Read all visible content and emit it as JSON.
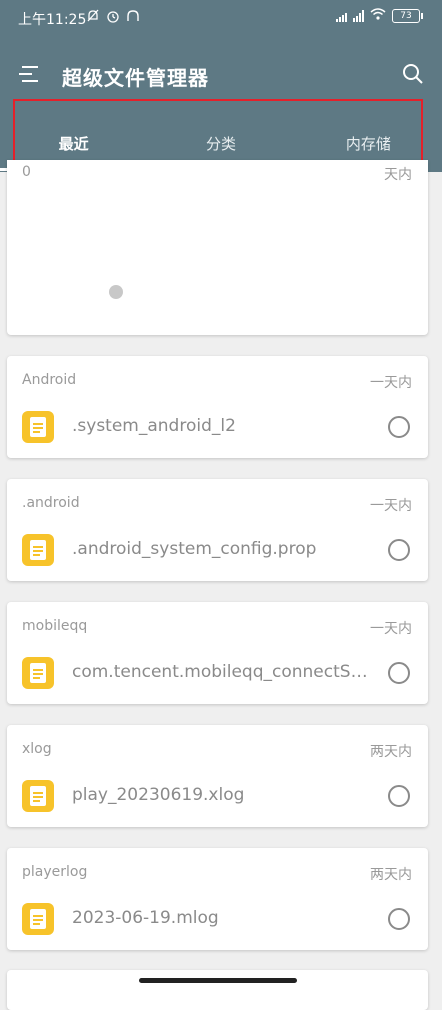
{
  "status_bar": {
    "time": "上午11:25",
    "battery": "73"
  },
  "app": {
    "title": "超级文件管理器"
  },
  "tabs": [
    {
      "label": "最近",
      "active": true
    },
    {
      "label": "分类",
      "active": false
    },
    {
      "label": "内存储",
      "active": false
    }
  ],
  "first_card": {
    "folder_fragment": "0",
    "time_fragment": "天内"
  },
  "items": [
    {
      "folder": "Android",
      "time": "一天内",
      "file": ".system_android_l2"
    },
    {
      "folder": ".android",
      "time": "一天内",
      "file": ".android_system_config.prop"
    },
    {
      "folder": "mobileqq",
      "time": "一天内",
      "file": "com.tencent.mobileqq_connectSdk...."
    },
    {
      "folder": "xlog",
      "time": "两天内",
      "file": "play_20230619.xlog"
    },
    {
      "folder": "playerlog",
      "time": "两天内",
      "file": "2023-06-19.mlog"
    }
  ],
  "colors": {
    "header": "#5e7984",
    "file_icon": "#f7c32a",
    "highlight": "#e5202a"
  },
  "icons": [
    "menu-icon",
    "search-icon",
    "file-icon",
    "radio-icon",
    "battery-icon",
    "wifi-icon",
    "signal-icon",
    "alarm-icon",
    "mute-icon",
    "headset-icon"
  ]
}
